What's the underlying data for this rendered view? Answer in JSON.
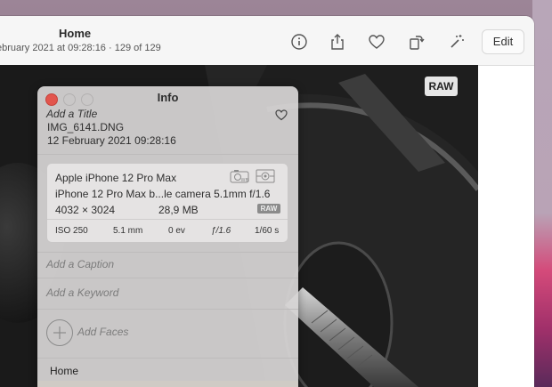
{
  "window": {
    "title": "Home",
    "subtitle": "ebruary 2021 at 09:28:16 · 129 of 129",
    "edit_label": "Edit"
  },
  "toolbar": {
    "icons": [
      "info-icon",
      "share-icon",
      "heart-icon",
      "rotate-icon",
      "magic-wand-icon"
    ]
  },
  "photo": {
    "raw_badge": "RAW"
  },
  "info": {
    "title": "Info",
    "add_title": "Add a Title",
    "filename": "IMG_6141.DNG",
    "datetime": "12 February 2021   09:28:16",
    "camera_model": "Apple iPhone 12 Pro Max",
    "lens": "iPhone 12 Pro Max b...le camera 5.1mm f/1.6",
    "resolution": "4032 × 3024",
    "filesize": "28,9 MB",
    "raw_tag": "RAW",
    "iso": "ISO 250",
    "focal": "5.1 mm",
    "ev": "0 ev",
    "aperture": "ƒ/1.6",
    "shutter": "1/60 s",
    "add_caption": "Add a Caption",
    "add_keyword": "Add a Keyword",
    "add_faces": "Add Faces",
    "location": "Home"
  }
}
